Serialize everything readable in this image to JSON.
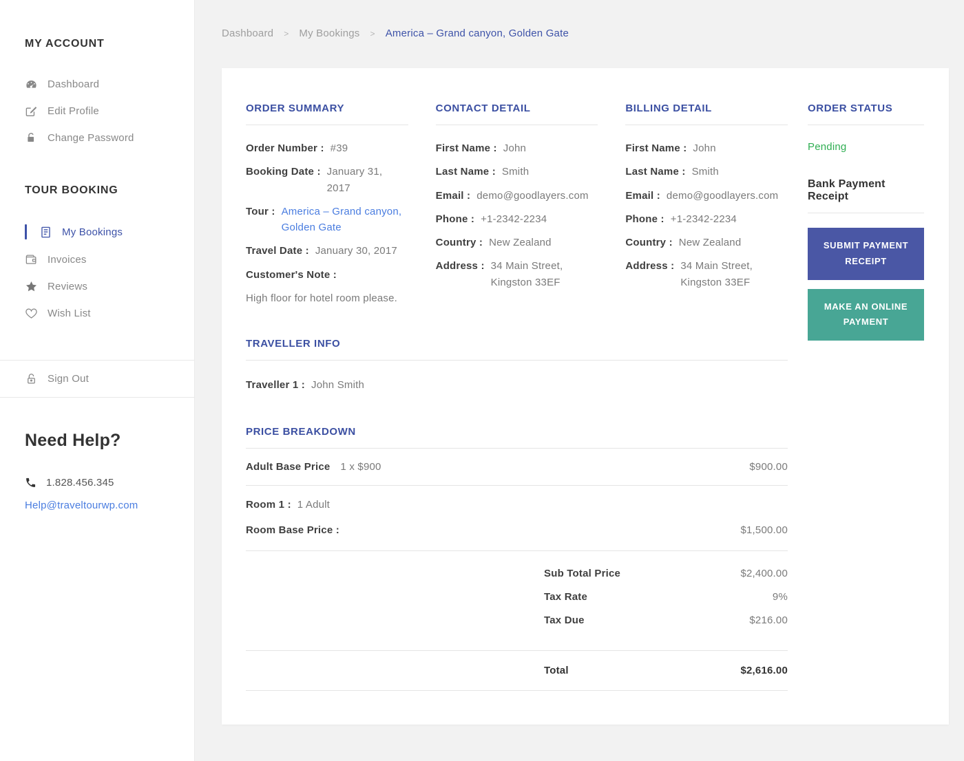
{
  "colors": {
    "heading_blue": "#3b4fa2",
    "link_blue": "#4a7de0",
    "active_sidebar_blue": "#3d52a8",
    "status_green": "#2fae52",
    "submit_button_bg": "#4a57a5",
    "online_button_bg": "#48a695"
  },
  "sidebar": {
    "my_account_title": "MY ACCOUNT",
    "account_items": [
      {
        "label": "Dashboard",
        "icon": "dashboard-icon"
      },
      {
        "label": "Edit Profile",
        "icon": "edit-icon"
      },
      {
        "label": "Change Password",
        "icon": "lock-icon"
      }
    ],
    "tour_booking_title": "TOUR BOOKING",
    "booking_items": [
      {
        "label": "My Bookings",
        "icon": "bookings-icon",
        "active": true
      },
      {
        "label": "Invoices",
        "icon": "wallet-icon"
      },
      {
        "label": "Reviews",
        "icon": "star-icon"
      },
      {
        "label": "Wish List",
        "icon": "heart-icon"
      }
    ],
    "sign_out_label": "Sign Out",
    "help": {
      "title": "Need Help?",
      "phone": "1.828.456.345",
      "email": "Help@traveltourwp.com"
    }
  },
  "breadcrumb": {
    "item1": "Dashboard",
    "item2": "My Bookings",
    "current": "America – Grand canyon, Golden Gate",
    "separator": ">"
  },
  "order_summary": {
    "title": "ORDER SUMMARY",
    "order_number_label": "Order Number :",
    "order_number": "#39",
    "booking_date_label": "Booking Date :",
    "booking_date": "January 31, 2017",
    "tour_label": "Tour :",
    "tour_link": "America – Grand canyon,\nGolden Gate",
    "travel_date_label": "Travel Date :",
    "travel_date": "January 30, 2017",
    "customer_note_label": "Customer's Note :",
    "customer_note": "High floor for hotel room please."
  },
  "contact_detail": {
    "title": "CONTACT DETAIL",
    "rows": [
      {
        "label": "First Name :",
        "value": "John"
      },
      {
        "label": "Last Name :",
        "value": "Smith"
      },
      {
        "label": "Email :",
        "value": "demo@goodlayers.com"
      },
      {
        "label": "Phone :",
        "value": "+1-2342-2234"
      },
      {
        "label": "Country :",
        "value": "New Zealand"
      },
      {
        "label": "Address :",
        "value": "34 Main Street,\nKingston 33EF"
      }
    ]
  },
  "billing_detail": {
    "title": "BILLING DETAIL",
    "rows": [
      {
        "label": "First Name :",
        "value": "John"
      },
      {
        "label": "Last Name :",
        "value": "Smith"
      },
      {
        "label": "Email :",
        "value": "demo@goodlayers.com"
      },
      {
        "label": "Phone :",
        "value": "+1-2342-2234"
      },
      {
        "label": "Country :",
        "value": "New Zealand"
      },
      {
        "label": "Address :",
        "value": "34 Main Street,\nKingston 33EF"
      }
    ]
  },
  "order_status": {
    "title": "ORDER STATUS",
    "status": "Pending",
    "bank_receipt_label": "Bank Payment Receipt",
    "submit_button": "SUBMIT PAYMENT RECEIPT",
    "online_button": "MAKE AN ONLINE PAYMENT"
  },
  "traveller_info": {
    "title": "TRAVELLER INFO",
    "traveller_label": "Traveller 1 :",
    "traveller_name": "John Smith"
  },
  "price_breakdown": {
    "title": "PRICE BREAKDOWN",
    "adult_base_label": "Adult Base Price",
    "adult_base_qty": "1 x $900",
    "adult_base_amount": "$900.00",
    "room_label": "Room 1 :",
    "room_occupancy": "1 Adult",
    "room_base_label": "Room Base Price :",
    "room_base_amount": "$1,500.00",
    "subtotal_label": "Sub Total Price",
    "subtotal_amount": "$2,400.00",
    "tax_rate_label": "Tax Rate",
    "tax_rate": "9%",
    "tax_due_label": "Tax Due",
    "tax_due_amount": "$216.00",
    "total_label": "Total",
    "total_amount": "$2,616.00"
  }
}
